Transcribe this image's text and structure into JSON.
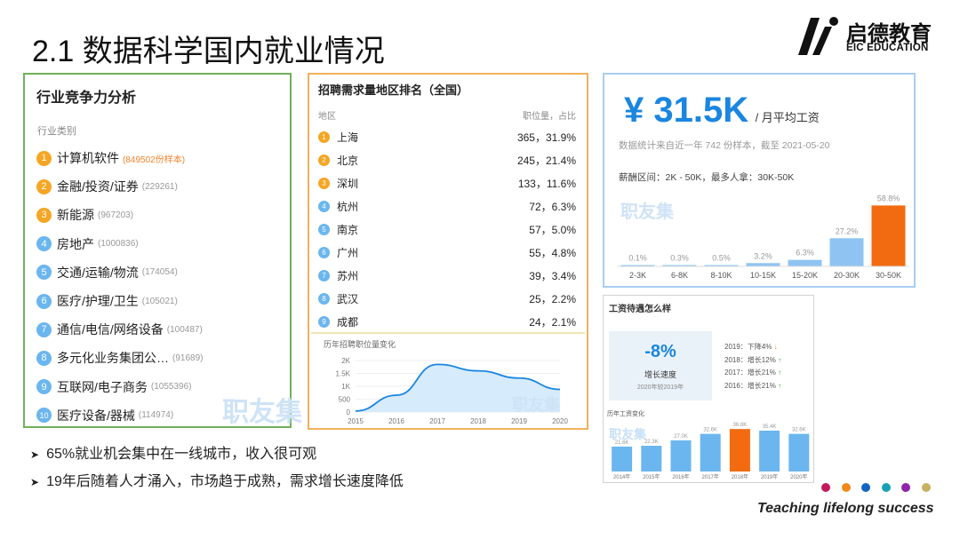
{
  "slide": {
    "title": "2.1 数据科学国内就业情况",
    "tagline": "Teaching lifelong success",
    "dot_colors": [
      "#c2185b",
      "#ef8a1a",
      "#1565c0",
      "#1aa0b4",
      "#8e24aa",
      "#c8b060"
    ]
  },
  "logo": {
    "cn": "启德教育",
    "en": "EIC EDUCATION"
  },
  "industry": {
    "title": "行业竞争力分析",
    "subtitle": "行业类别",
    "watermark": "职友集",
    "items": [
      {
        "rank": "1",
        "name": "计算机软件",
        "count": "(849502份样本)"
      },
      {
        "rank": "2",
        "name": "金融/投资/证券",
        "count": "(229261)"
      },
      {
        "rank": "3",
        "name": "新能源",
        "count": "(967203)"
      },
      {
        "rank": "4",
        "name": "房地产",
        "count": "(1000836)"
      },
      {
        "rank": "5",
        "name": "交通/运输/物流",
        "count": "(174054)"
      },
      {
        "rank": "6",
        "name": "医疗/护理/卫生",
        "count": "(105021)"
      },
      {
        "rank": "7",
        "name": "通信/电信/网络设备",
        "count": "(100487)"
      },
      {
        "rank": "8",
        "name": "多元化业务集团公…",
        "count": "(91689)"
      },
      {
        "rank": "9",
        "name": "互联网/电子商务",
        "count": "(1055396)"
      },
      {
        "rank": "10",
        "name": "医疗设备/器械",
        "count": "(114974)"
      }
    ]
  },
  "regions": {
    "title": "招聘需求量地区排名（全国）",
    "col_region": "地区",
    "col_share": "职位量，占比",
    "items": [
      {
        "rank": "1",
        "city": "上海",
        "value": "365，31.9%"
      },
      {
        "rank": "2",
        "city": "北京",
        "value": "245，21.4%"
      },
      {
        "rank": "3",
        "city": "深圳",
        "value": "133，11.6%"
      },
      {
        "rank": "4",
        "city": "杭州",
        "value": "72，6.3%"
      },
      {
        "rank": "5",
        "city": "南京",
        "value": "57，5.0%"
      },
      {
        "rank": "6",
        "city": "广州",
        "value": "55，4.8%"
      },
      {
        "rank": "7",
        "city": "苏州",
        "value": "39，3.4%"
      },
      {
        "rank": "8",
        "city": "武汉",
        "value": "25，2.2%"
      },
      {
        "rank": "9",
        "city": "成都",
        "value": "24，2.1%"
      }
    ],
    "trend_title": "历年招聘职位量变化",
    "watermark": "职友集"
  },
  "salary": {
    "value": "¥ 31.5K",
    "unit": "/ 月平均工资",
    "note": "数据统计来自近一年 742 份样本，截至 2021-05-20",
    "range": "薪酬区间：2K - 50K，最多人拿：30K-50K",
    "watermark": "职友集"
  },
  "wage": {
    "title": "工资待遇怎么样",
    "growth_value": "-8%",
    "growth_label": "增长速度",
    "growth_sub": "2020年较2019年",
    "history": [
      {
        "label": "2019：下降4%",
        "dir": "down"
      },
      {
        "label": "2018：增长12%",
        "dir": "up"
      },
      {
        "label": "2017：增长21%",
        "dir": "up"
      },
      {
        "label": "2016：增长21%",
        "dir": "up"
      }
    ],
    "hist_title": "历年工资变化",
    "watermark": "职友集"
  },
  "bullets": [
    "65%就业机会集中在一线城市，收入很可观",
    "19年后随着人才涌入，市场趋于成熟，需求增长速度降低"
  ],
  "chart_data": [
    {
      "type": "line",
      "title": "历年招聘职位量变化",
      "x": [
        2015,
        2016,
        2017,
        2018,
        2019,
        2020
      ],
      "values": [
        40,
        650,
        1850,
        1600,
        1320,
        880
      ],
      "y_ticks": [
        "0",
        "500",
        "1K",
        "1.5K",
        "2K"
      ],
      "ylim": [
        0,
        2000
      ],
      "color": "#1a86e0",
      "area_color": "#d6ebfb",
      "grid": true
    },
    {
      "type": "bar",
      "categories": [
        "2-3K",
        "6-8K",
        "8-10K",
        "10-15K",
        "15-20K",
        "20-30K",
        "30-50K"
      ],
      "values": [
        0.1,
        0.3,
        0.5,
        3.2,
        6.3,
        27.2,
        58.8
      ],
      "labels": [
        "0.1%",
        "0.3%",
        "0.5%",
        "3.2%",
        "6.3%",
        "27.2%",
        "58.8%"
      ],
      "ylim": [
        0,
        60
      ],
      "highlight_index": 6,
      "color": "#8fc4f2",
      "highlight_color": "#f26b10"
    },
    {
      "type": "bar",
      "categories": [
        "2014年",
        "2015年",
        "2016年",
        "2017年",
        "2018年",
        "2019年",
        "2020年"
      ],
      "values": [
        21.6,
        22.3,
        27.0,
        32.6,
        36.8,
        35.4,
        32.6
      ],
      "labels": [
        "21.6K",
        "22.3K",
        "27.0K",
        "32.6K",
        "36.8K",
        "35.4K",
        "32.6K"
      ],
      "ylim": [
        0,
        40
      ],
      "highlight_index": 4,
      "color": "#6bb6ef",
      "highlight_color": "#f26b10"
    }
  ]
}
